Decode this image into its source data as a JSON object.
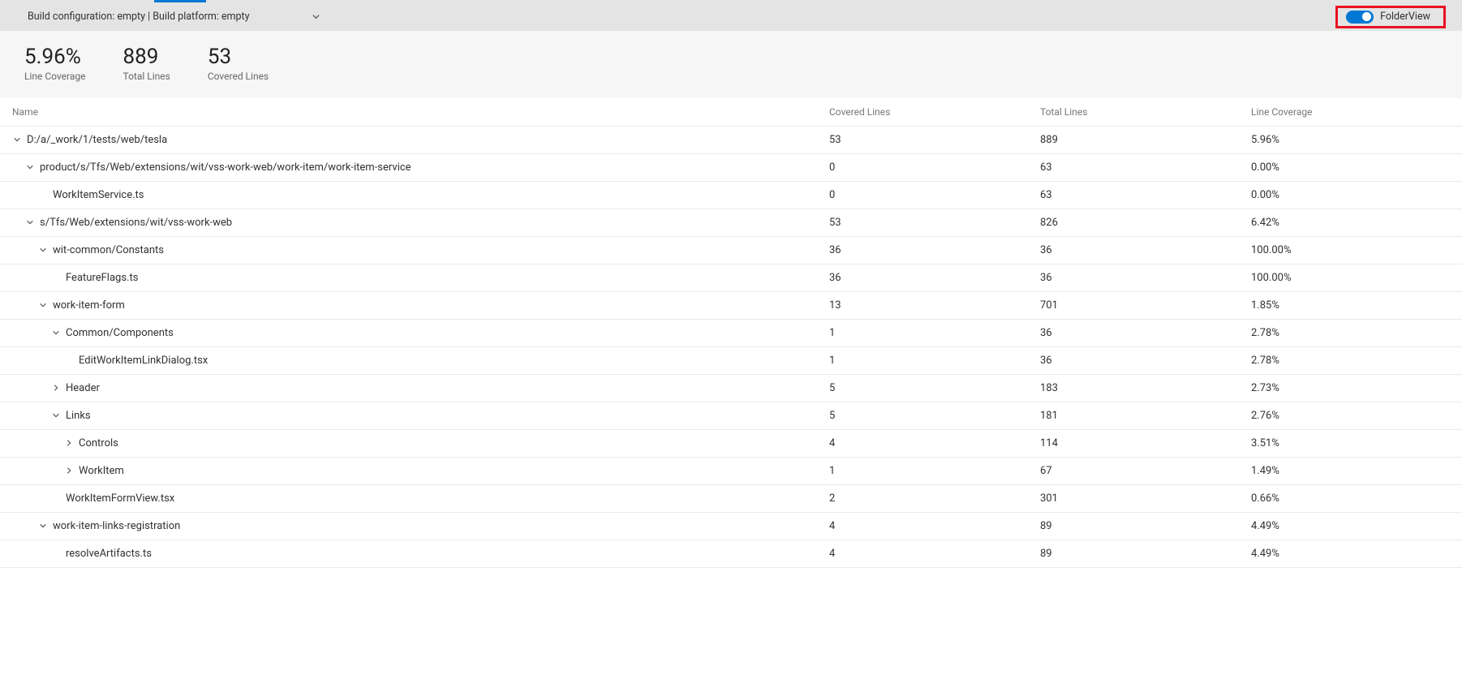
{
  "config": {
    "text": "Build configuration: empty | Build platform: empty"
  },
  "toggle": {
    "label": "FolderView"
  },
  "summary": {
    "coverage_value": "5.96%",
    "coverage_label": "Line Coverage",
    "total_value": "889",
    "total_label": "Total Lines",
    "covered_value": "53",
    "covered_label": "Covered Lines"
  },
  "headers": {
    "name": "Name",
    "covered": "Covered Lines",
    "total": "Total Lines",
    "linecov": "Line Coverage"
  },
  "rows": [
    {
      "indent": 0,
      "chev": "down",
      "name": "D:/a/_work/1/tests/web/tesla",
      "covered": "53",
      "total": "889",
      "linecov": "5.96%"
    },
    {
      "indent": 1,
      "chev": "down",
      "name": "product/s/Tfs/Web/extensions/wit/vss-work-web/work-item/work-item-service",
      "covered": "0",
      "total": "63",
      "linecov": "0.00%"
    },
    {
      "indent": 2,
      "chev": "none",
      "name": "WorkItemService.ts",
      "covered": "0",
      "total": "63",
      "linecov": "0.00%"
    },
    {
      "indent": 1,
      "chev": "down",
      "name": "s/Tfs/Web/extensions/wit/vss-work-web",
      "covered": "53",
      "total": "826",
      "linecov": "6.42%"
    },
    {
      "indent": 2,
      "chev": "down",
      "name": "wit-common/Constants",
      "covered": "36",
      "total": "36",
      "linecov": "100.00%"
    },
    {
      "indent": 3,
      "chev": "none",
      "name": "FeatureFlags.ts",
      "covered": "36",
      "total": "36",
      "linecov": "100.00%"
    },
    {
      "indent": 2,
      "chev": "down",
      "name": "work-item-form",
      "covered": "13",
      "total": "701",
      "linecov": "1.85%"
    },
    {
      "indent": 3,
      "chev": "down",
      "name": "Common/Components",
      "covered": "1",
      "total": "36",
      "linecov": "2.78%"
    },
    {
      "indent": 4,
      "chev": "none",
      "name": "EditWorkItemLinkDialog.tsx",
      "covered": "1",
      "total": "36",
      "linecov": "2.78%"
    },
    {
      "indent": 3,
      "chev": "right",
      "name": "Header",
      "covered": "5",
      "total": "183",
      "linecov": "2.73%"
    },
    {
      "indent": 3,
      "chev": "down",
      "name": "Links",
      "covered": "5",
      "total": "181",
      "linecov": "2.76%"
    },
    {
      "indent": 4,
      "chev": "right",
      "name": "Controls",
      "covered": "4",
      "total": "114",
      "linecov": "3.51%"
    },
    {
      "indent": 4,
      "chev": "right",
      "name": "WorkItem",
      "covered": "1",
      "total": "67",
      "linecov": "1.49%"
    },
    {
      "indent": 3,
      "chev": "none",
      "name": "WorkItemFormView.tsx",
      "covered": "2",
      "total": "301",
      "linecov": "0.66%"
    },
    {
      "indent": 2,
      "chev": "down",
      "name": "work-item-links-registration",
      "covered": "4",
      "total": "89",
      "linecov": "4.49%"
    },
    {
      "indent": 3,
      "chev": "none",
      "name": "resolveArtifacts.ts",
      "covered": "4",
      "total": "89",
      "linecov": "4.49%"
    }
  ]
}
